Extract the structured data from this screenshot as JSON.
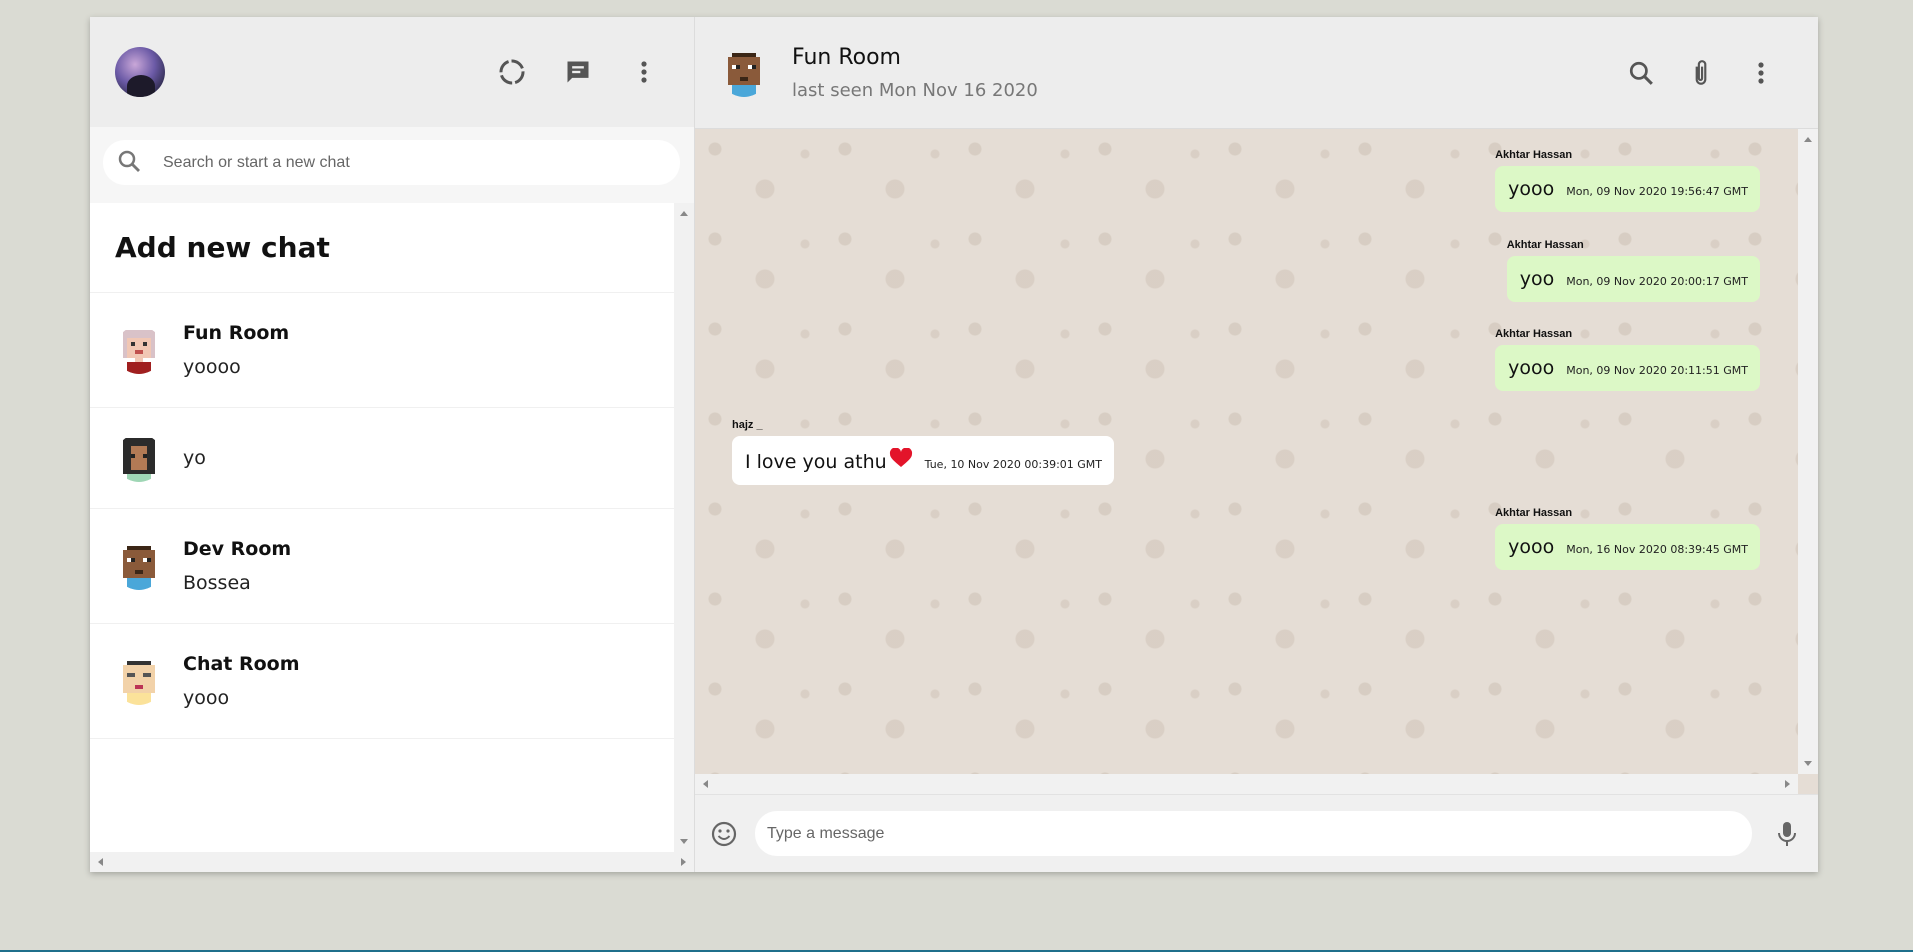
{
  "sidebar": {
    "search_placeholder": "Search or start a new chat",
    "add_new_chat": "Add new chat",
    "chats": [
      {
        "name": "Fun Room",
        "last": "yoooo"
      },
      {
        "name": "",
        "last": "yo"
      },
      {
        "name": "Dev Room",
        "last": "Bossea"
      },
      {
        "name": "Chat Room",
        "last": "yooo"
      }
    ]
  },
  "chat": {
    "title": "Fun Room",
    "subtitle": "last seen Mon Nov 16 2020",
    "input_placeholder": "Type a message",
    "messages": [
      {
        "sender": "Akhtar Hassan",
        "text": "yooo",
        "time": "Mon, 09 Nov 2020 19:56:47 GMT",
        "mine": true
      },
      {
        "sender": "Akhtar Hassan",
        "text": "yoo",
        "time": "Mon, 09 Nov 2020 20:00:17 GMT",
        "mine": true
      },
      {
        "sender": "Akhtar Hassan",
        "text": "yooo",
        "time": "Mon, 09 Nov 2020 20:11:51 GMT",
        "mine": true
      },
      {
        "sender": "hajz _",
        "text": "I love you athu",
        "time": "Tue, 10 Nov 2020 00:39:01 GMT",
        "mine": false
      },
      {
        "sender": "Akhtar Hassan",
        "text": "yooo",
        "time": "Mon, 16 Nov 2020 08:39:45 GMT",
        "mine": true
      }
    ]
  },
  "colors": {
    "sent_bubble": "#dcf8c6",
    "received_bubble": "#ffffff",
    "header_bg": "#ededed",
    "chat_bg": "#e5ddd5"
  },
  "icons": [
    "status-icon",
    "new-chat-icon",
    "menu-icon",
    "search-icon",
    "attach-icon",
    "emoji-icon",
    "mic-icon",
    "heart-icon"
  ]
}
